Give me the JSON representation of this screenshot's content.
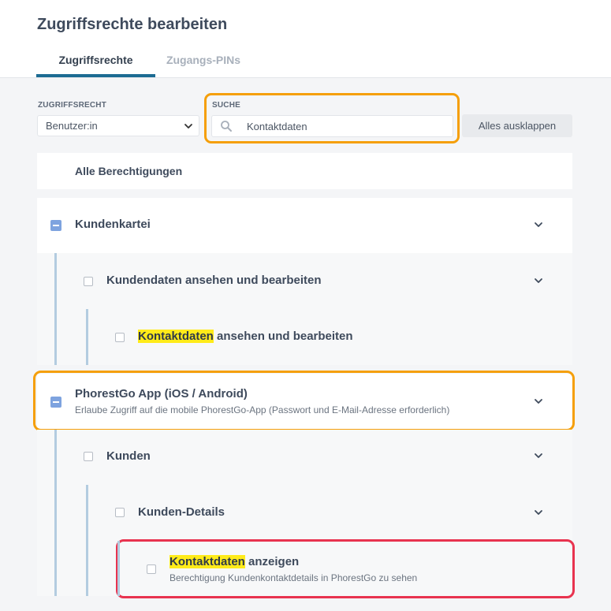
{
  "header": {
    "title": "Zugriffsrechte bearbeiten",
    "tabs": [
      {
        "label": "Zugriffsrechte",
        "active": true
      },
      {
        "label": "Zugangs-PINs",
        "active": false
      }
    ]
  },
  "filters": {
    "role_label": "ZUGRIFFSRECHT",
    "role_value": "Benutzer:in",
    "search_label": "SUCHE",
    "search_value": "Kontaktdaten",
    "expand_button": "Alles ausklappen"
  },
  "tree": {
    "all_label": "Alle Berechtigungen",
    "groups": [
      {
        "label": "Kundenkartei",
        "state": "partial",
        "children": [
          {
            "label": "Kundendaten ansehen und bearbeiten",
            "children": [
              {
                "highlight": "Kontaktdaten",
                "rest": " ansehen und bearbeiten"
              }
            ]
          }
        ]
      },
      {
        "label": "PhorestGo App (iOS / Android)",
        "description": "Erlaube Zugriff auf die mobile PhorestGo-App (Passwort und E-Mail-Adresse erforderlich)",
        "state": "partial",
        "children": [
          {
            "label": "Kunden",
            "children": [
              {
                "label": "Kunden-Details",
                "children": [
                  {
                    "highlight": "Kontaktdaten",
                    "rest": " anzeigen",
                    "description": "Berechtigung Kundenkontaktdetails in PhorestGo zu sehen"
                  }
                ]
              }
            ]
          }
        ]
      }
    ]
  },
  "colors": {
    "accent_tab": "#1c6b93",
    "highlight_orange": "#f59f0a",
    "highlight_red": "#e8334f",
    "search_match": "#ffeb1a",
    "partial_checkbox": "#7ea3df",
    "tree_line": "#b3cce0"
  },
  "icons": {
    "search": "search-icon",
    "select": "chevron-down-icon",
    "rows": "chevron-down-icon",
    "group_state": "minus-checkbox-icon"
  }
}
